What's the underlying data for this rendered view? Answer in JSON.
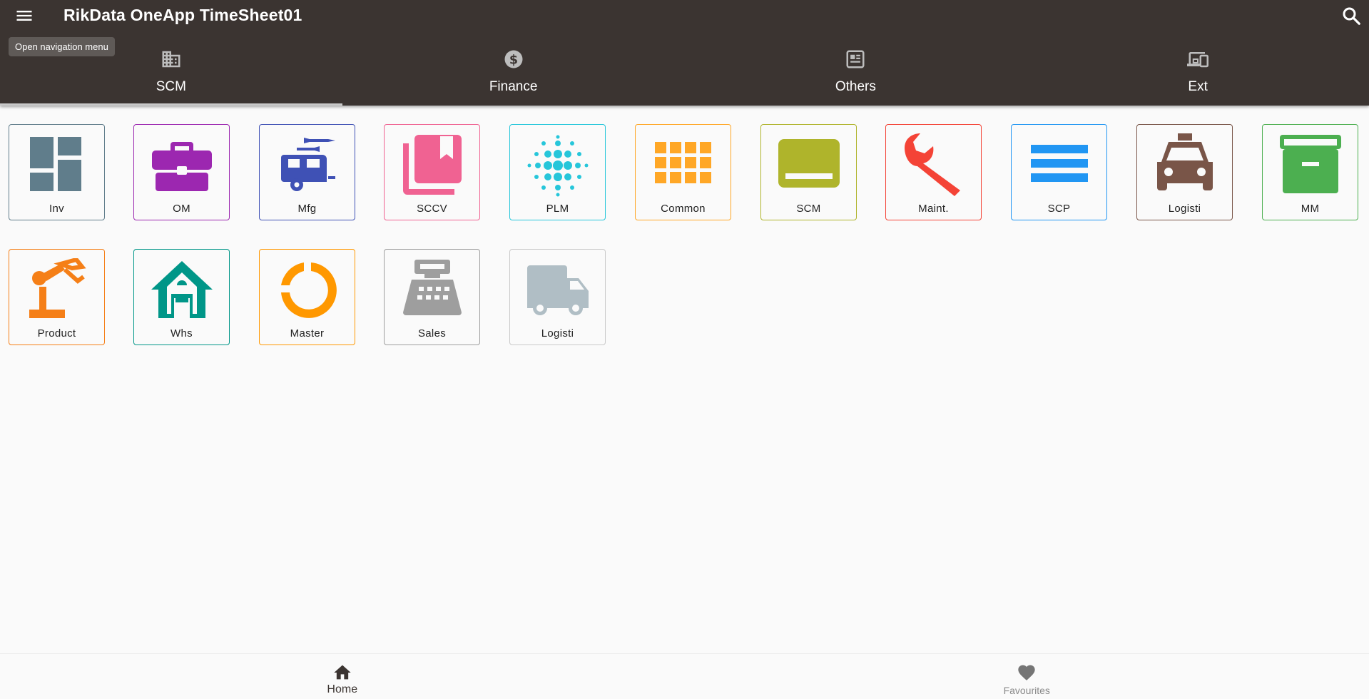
{
  "appbar": {
    "title": "RikData OneApp TimeSheet01",
    "tooltip": "Open navigation menu",
    "background": "#3b3431"
  },
  "tabs": [
    {
      "label": "SCM",
      "icon": "business-icon",
      "active": true
    },
    {
      "label": "Finance",
      "icon": "dollar-circle-icon",
      "active": false
    },
    {
      "label": "Others",
      "icon": "newspaper-icon",
      "active": false
    },
    {
      "label": "Ext",
      "icon": "devices-icon",
      "active": false
    }
  ],
  "tiles": [
    {
      "label": "Inv",
      "icon": "dashboard-icon",
      "color": "#607d8b"
    },
    {
      "label": "OM",
      "icon": "briefcase-icon",
      "color": "#9c27b0"
    },
    {
      "label": "Mfg",
      "icon": "rv-swap-icon",
      "color": "#3f51b5"
    },
    {
      "label": "SCCV",
      "icon": "library-books-icon",
      "color": "#f06292"
    },
    {
      "label": "PLM",
      "icon": "blur-dots-icon",
      "color": "#26c6da"
    },
    {
      "label": "Common",
      "icon": "grid-icon",
      "color": "#ffa726"
    },
    {
      "label": "SCM",
      "icon": "caption-icon",
      "color": "#afb42b"
    },
    {
      "label": "Maint.",
      "icon": "wrench-icon",
      "color": "#f44336"
    },
    {
      "label": "SCP",
      "icon": "menu-lines-icon",
      "color": "#2196f3"
    },
    {
      "label": "Logisti",
      "icon": "taxi-icon",
      "color": "#795548"
    },
    {
      "label": "MM",
      "icon": "archive-box-icon",
      "color": "#4caf50"
    },
    {
      "label": "Product",
      "icon": "robot-arm-icon",
      "color": "#f57f17"
    },
    {
      "label": "Whs",
      "icon": "house-icon",
      "color": "#009688"
    },
    {
      "label": "Master",
      "icon": "donut-icon",
      "color": "#ff9800"
    },
    {
      "label": "Sales",
      "icon": "cash-register-icon",
      "color": "#9e9e9e"
    },
    {
      "label": "Logisti",
      "icon": "truck-icon",
      "color": "#b0bec5"
    }
  ],
  "bottom_nav": [
    {
      "label": "Home",
      "icon": "home-icon"
    },
    {
      "label": "Favourites",
      "icon": "heart-icon"
    }
  ]
}
